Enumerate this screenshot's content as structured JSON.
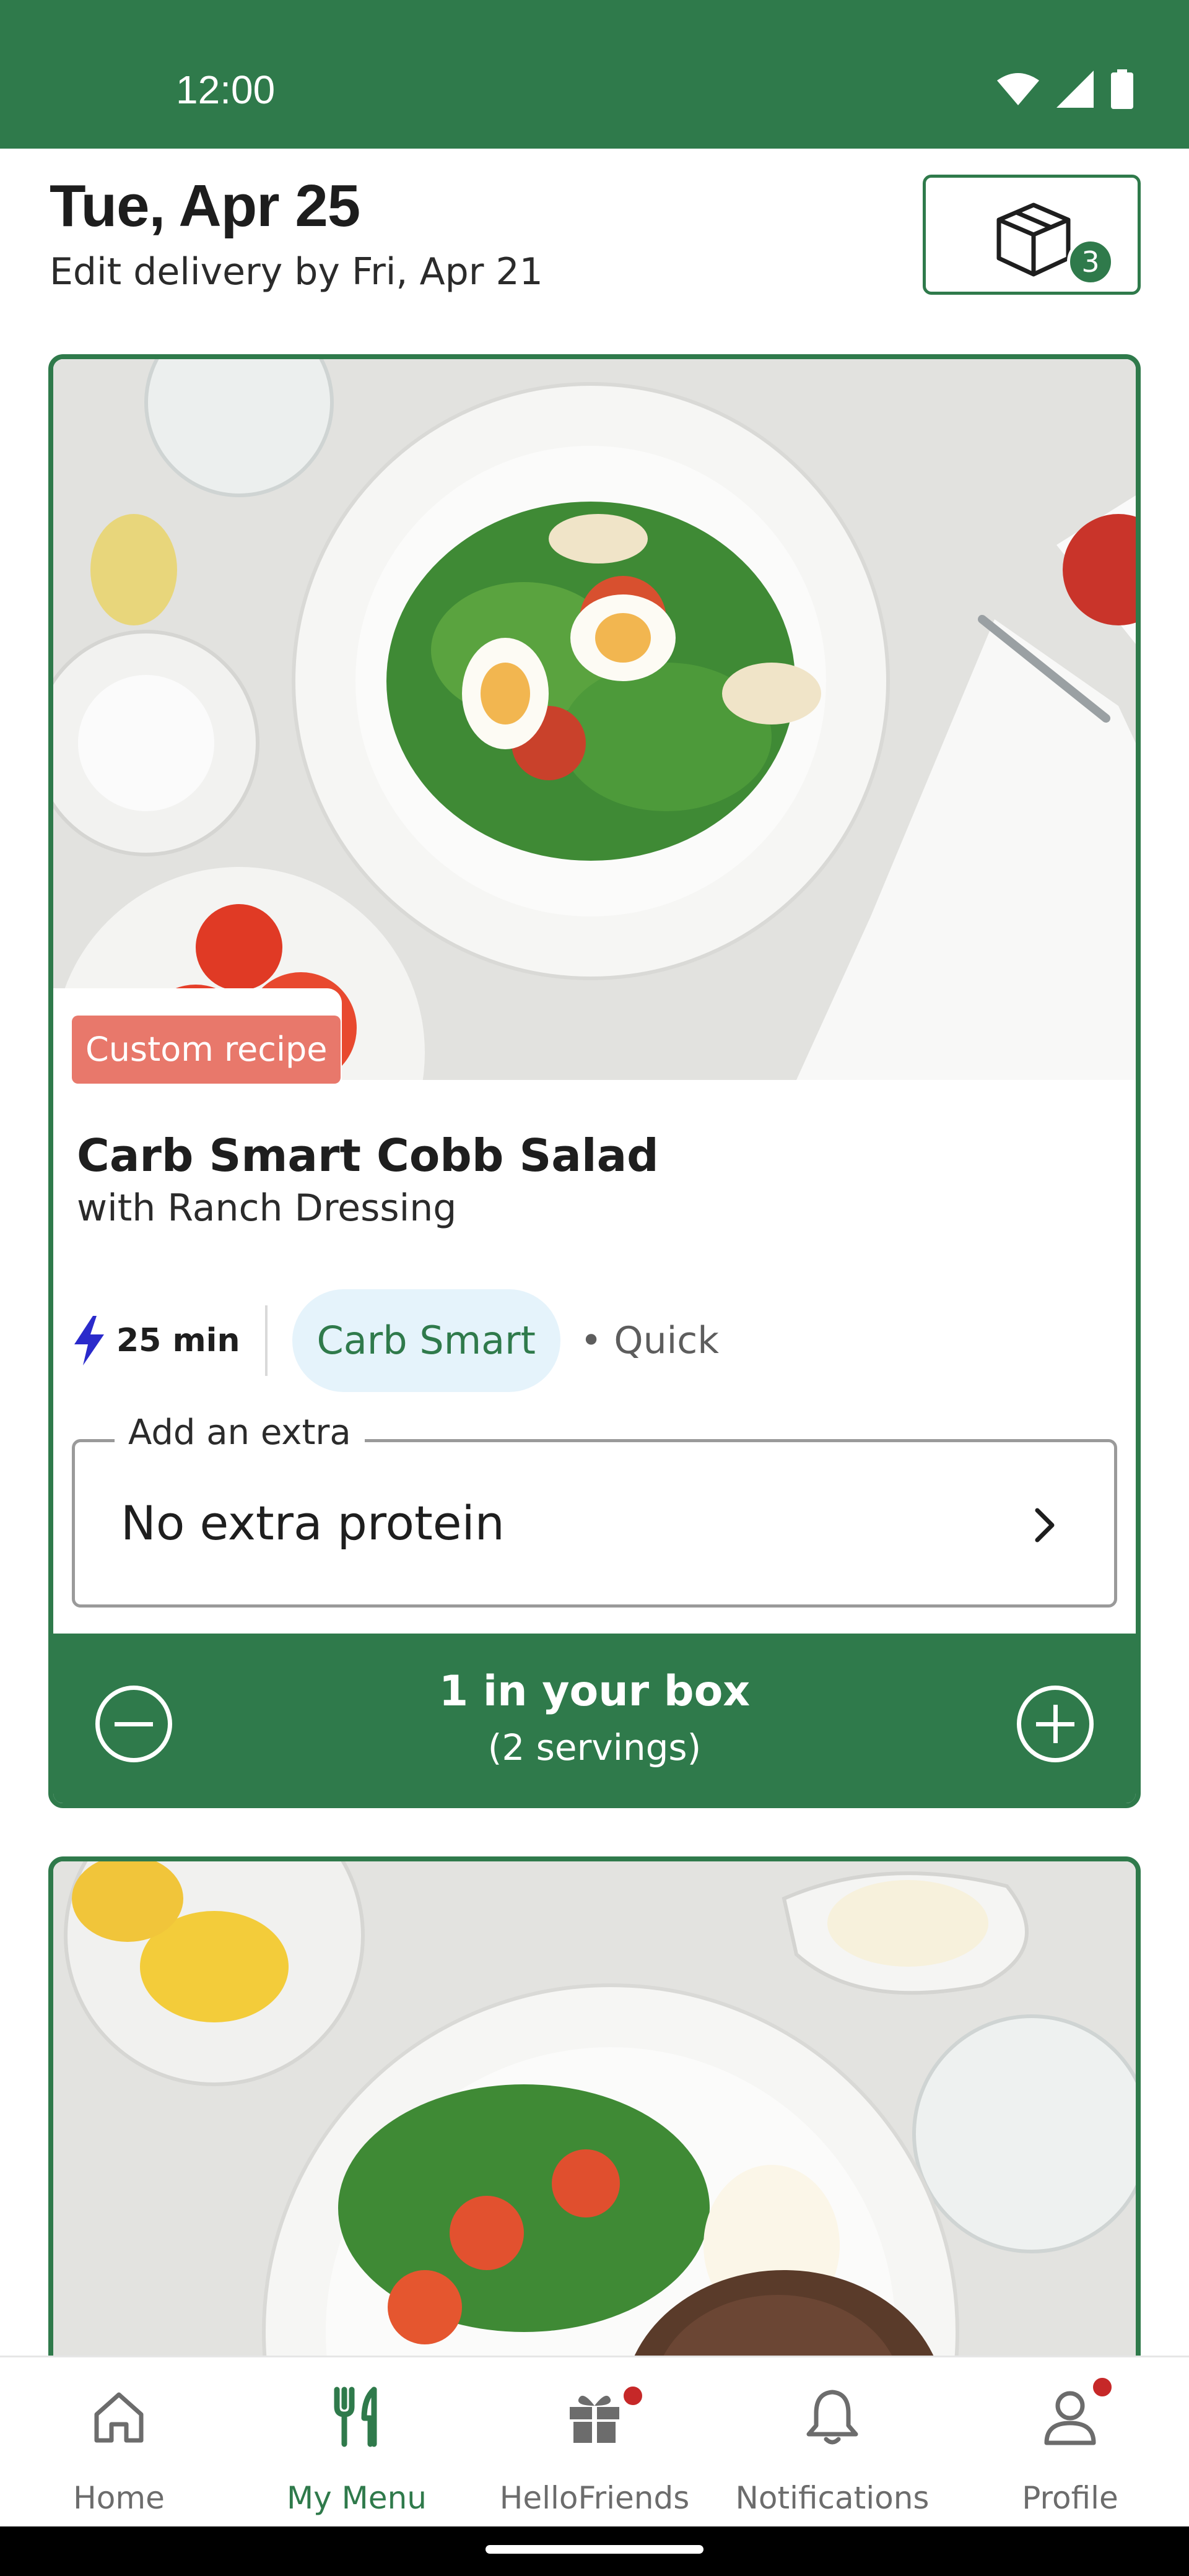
{
  "status_bar": {
    "time": "12:00",
    "icons": [
      "wifi-icon",
      "signal-icon",
      "battery-icon"
    ]
  },
  "header": {
    "date": "Tue, Apr 25",
    "edit_text": "Edit delivery by Fri, Apr 21",
    "box_count": "3",
    "box_icon": "box-icon"
  },
  "recipes": [
    {
      "badge": "Custom recipe",
      "title": "Carb Smart Cobb Salad",
      "subtitle": "with Ranch Dressing",
      "time": "25 min",
      "tag": "Carb Smart",
      "extra_tag": "• Quick",
      "extra_label": "Add an extra",
      "extra_value": "No extra protein",
      "quantity_main": "1 in your box",
      "quantity_sub": "(2 servings)"
    },
    {}
  ],
  "bottom_nav": {
    "items": [
      {
        "label": "Home",
        "icon": "home-icon",
        "active": false,
        "dot": false
      },
      {
        "label": "My Menu",
        "icon": "fork-knife-icon",
        "active": true,
        "dot": false
      },
      {
        "label": "HelloFriends",
        "icon": "gift-icon",
        "active": false,
        "dot": true
      },
      {
        "label": "Notifications",
        "icon": "bell-icon",
        "active": false,
        "dot": false
      },
      {
        "label": "Profile",
        "icon": "profile-icon",
        "active": false,
        "dot": true
      }
    ]
  },
  "colors": {
    "brand_green": "#2f7a4b",
    "badge_coral": "#e8786b",
    "chip_bg": "#e5f3fb",
    "lightning_blue": "#2a2acb",
    "notification_dot": "#c62828"
  }
}
